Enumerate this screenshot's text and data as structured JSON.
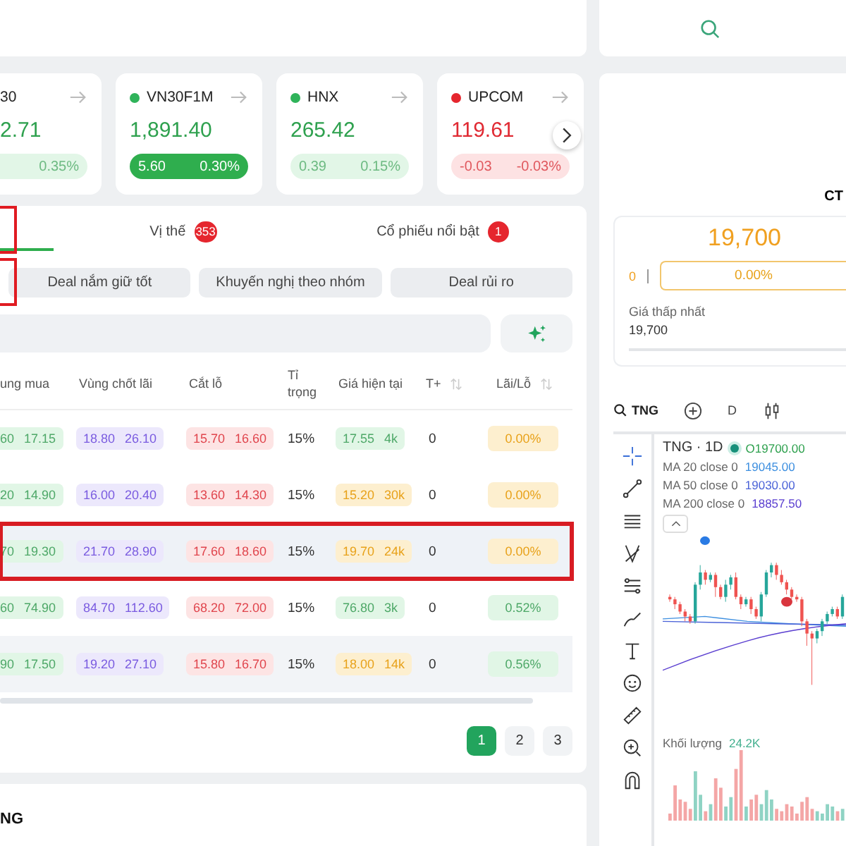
{
  "indices": [
    {
      "name": "30",
      "value": "2.71",
      "rising": true,
      "filled": false,
      "percent": "0.35%"
    },
    {
      "name": "VN30F1M",
      "color": "#2fb35a",
      "value": "1,891.40",
      "rising": true,
      "filled": true,
      "change": "5.60",
      "percent": "0.30%"
    },
    {
      "name": "HNX",
      "color": "#2fb35a",
      "value": "265.42",
      "rising": true,
      "filled": false,
      "change": "0.39",
      "percent": "0.15%"
    },
    {
      "name": "UPCOM",
      "color": "#e5262e",
      "value": "119.61",
      "rising": false,
      "filled": false,
      "change": "-0.03",
      "percent": "-0.03%"
    }
  ],
  "tabs": [
    {
      "selected": true
    },
    {
      "label": "Vị thế",
      "badge": "353",
      "selected": false
    },
    {
      "label": "Cổ phiếu nổi bật",
      "badge": "1",
      "selected": false
    }
  ],
  "filters": [
    {
      "label": "Deal nắm giữ tốt",
      "selected": false
    },
    {
      "label": "Khuyến nghị theo nhóm",
      "selected": false
    },
    {
      "label": "Deal rủi ro",
      "selected": false
    }
  ],
  "table": {
    "columns": [
      "ung mua",
      "Vùng chốt lãi",
      "Cắt lỗ",
      "Tỉ trọng",
      "Giá hiện tại",
      "T+",
      "Lãi/Lỗ"
    ],
    "rows": [
      {
        "buy": [
          "60",
          "17.15"
        ],
        "take_profit": [
          "18.80",
          "26.10"
        ],
        "stop_loss": [
          "15.70",
          "16.60"
        ],
        "weight": "15%",
        "price": [
          "17.55",
          "4k"
        ],
        "price_up": true,
        "t_plus": "0",
        "pnl": "0.00%",
        "pnl_up": false,
        "highlighted": false,
        "hovered": false
      },
      {
        "buy": [
          "20",
          "14.90"
        ],
        "take_profit": [
          "16.00",
          "20.40"
        ],
        "stop_loss": [
          "13.60",
          "14.30"
        ],
        "weight": "15%",
        "price": [
          "15.20",
          "30k"
        ],
        "price_up": false,
        "t_plus": "0",
        "pnl": "0.00%",
        "pnl_up": false,
        "highlighted": false,
        "hovered": false
      },
      {
        "buy": [
          "70",
          "19.30"
        ],
        "take_profit": [
          "21.70",
          "28.90"
        ],
        "stop_loss": [
          "17.60",
          "18.60"
        ],
        "weight": "15%",
        "price": [
          "19.70",
          "24k"
        ],
        "price_up": false,
        "t_plus": "0",
        "pnl": "0.00%",
        "pnl_up": false,
        "highlighted": true,
        "hovered": false
      },
      {
        "buy": [
          "60",
          "74.90"
        ],
        "take_profit": [
          "84.70",
          "112.60"
        ],
        "stop_loss": [
          "68.20",
          "72.00"
        ],
        "weight": "15%",
        "price": [
          "76.80",
          "3k"
        ],
        "price_up": true,
        "t_plus": "0",
        "pnl": "0.52%",
        "pnl_up": true,
        "highlighted": false,
        "hovered": false
      },
      {
        "buy": [
          "90",
          "17.50"
        ],
        "take_profit": [
          "19.20",
          "27.10"
        ],
        "stop_loss": [
          "15.80",
          "16.70"
        ],
        "weight": "15%",
        "price": [
          "18.00",
          "14k"
        ],
        "price_up": false,
        "t_plus": "0",
        "pnl": "0.56%",
        "pnl_up": true,
        "highlighted": false,
        "hovered": true
      }
    ]
  },
  "pages": [
    {
      "label": "1",
      "selected": true
    },
    {
      "label": "2",
      "selected": false
    },
    {
      "label": "3",
      "selected": false
    }
  ],
  "bottom_title": "NG",
  "detail": {
    "heading": "CT",
    "price": "19,700",
    "volume": "0",
    "percent": "0.00%",
    "low_label": "Giá thấp nhất",
    "low_value": "19,700"
  },
  "chart": {
    "symbol": "TNG",
    "interval": "D",
    "legend_title": "TNG · 1D",
    "open": "O19700.00",
    "ma": [
      {
        "label": "MA 20 close 0",
        "value": "19045.00",
        "color": "#3d8fe0"
      },
      {
        "label": "MA 50 close 0",
        "value": "19030.00",
        "color": "#4b63d8"
      },
      {
        "label": "MA 200 close 0",
        "value": "18857.50",
        "color": "#5b3fd0"
      }
    ],
    "volume_label": "Khối lượng",
    "volume_value": "24.2K"
  }
}
